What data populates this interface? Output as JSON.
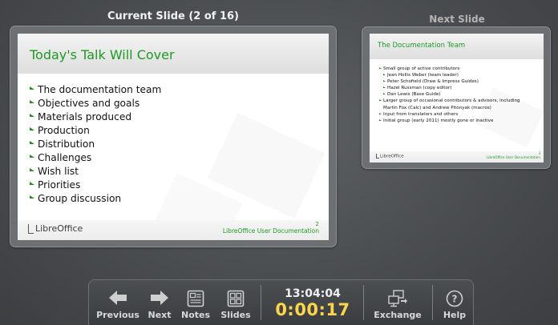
{
  "current_slide": {
    "header": "Current Slide (2 of 16)",
    "title": "Today's Talk Will Cover",
    "bullets": [
      "The documentation team",
      "Objectives and goals",
      "Materials produced",
      "Production",
      "Distribution",
      "Challenges",
      "Wish list",
      "Priorities",
      "Group discussion"
    ],
    "footer_logo": "LibreOffice",
    "footer_text": "LibreOffice User Documentation",
    "page_number": "2"
  },
  "next_slide": {
    "header": "Next Slide",
    "title": "The Documentation Team",
    "bullets": [
      {
        "text": "Small group of active contributors",
        "level": 1
      },
      {
        "text": "Jean Hollis Weber (team leader)",
        "level": 2
      },
      {
        "text": "Peter Schofield (Draw & Impress Guides)",
        "level": 2
      },
      {
        "text": "Hazel Russman (copy editor)",
        "level": 2
      },
      {
        "text": "Dan Lewis (Base Guide)",
        "level": 2
      },
      {
        "text": "Larger group of occasional contributors & advisors, including",
        "level": 1
      },
      {
        "text": "Martin Fox (Calc) and Andrew Pitonyak (macros)",
        "level": 1
      },
      {
        "text": "Input from translators and others",
        "level": 1
      },
      {
        "text": "Initial group (early 2011) mostly gone or inactive",
        "level": 1
      }
    ],
    "footer_logo": "LibreOffice",
    "footer_text": "LibreOffice User Documentation",
    "page_number": "3"
  },
  "toolbar": {
    "previous_label": "Previous",
    "next_label": "Next",
    "notes_label": "Notes",
    "slides_label": "Slides",
    "clock": "13:04:04",
    "timer": "0:00:17",
    "exchange_label": "Exchange",
    "help_label": "Help"
  },
  "colors": {
    "accent_green": "#1e9a23",
    "timer_yellow": "#ffd54a",
    "background": "#4a4d4f"
  },
  "icons": {
    "previous": "arrow-left-icon",
    "next": "arrow-right-icon",
    "notes": "notes-icon",
    "slides": "slides-grid-icon",
    "exchange": "exchange-screens-icon",
    "help": "help-question-icon"
  }
}
